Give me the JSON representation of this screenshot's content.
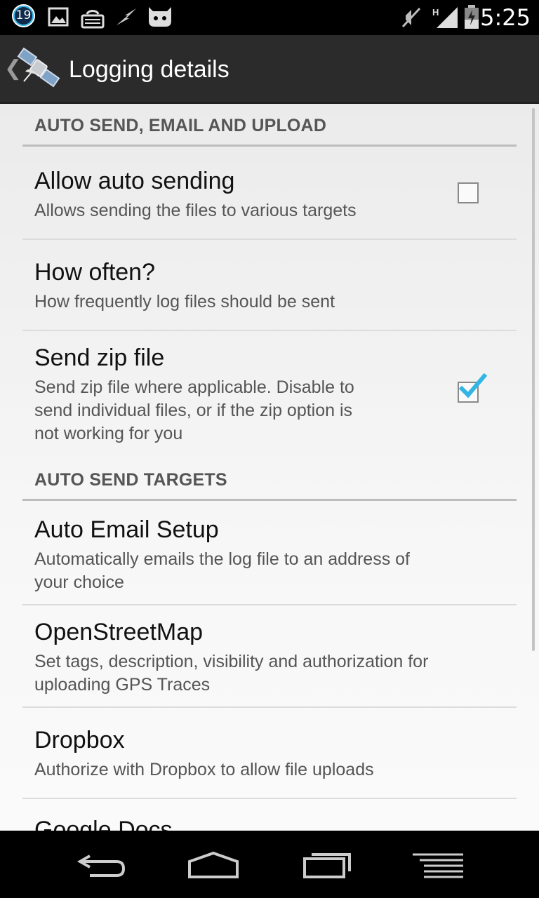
{
  "status_bar": {
    "notification_count": "19",
    "time": "5:25",
    "icons": [
      "notification-count-badge",
      "image-icon",
      "keyboard-icon",
      "lightning-icon",
      "android-cat-icon",
      "mute-icon",
      "signal-icon",
      "battery-icon"
    ]
  },
  "action_bar": {
    "title": "Logging details",
    "app_icon": "satellite-icon"
  },
  "sections": [
    {
      "header": "AUTO SEND, EMAIL AND UPLOAD",
      "items": [
        {
          "title": "Allow auto sending",
          "summary": "Allows sending the files to various targets",
          "checkbox": true,
          "checked": false
        },
        {
          "title": "How often?",
          "summary": "How frequently log files should be sent",
          "checkbox": false
        },
        {
          "title": "Send zip file",
          "summary_lines": [
            "Send zip file where applicable. Disable to",
            "send individual files, or if the zip option is",
            "not working for you"
          ],
          "checkbox": true,
          "checked": true
        }
      ]
    },
    {
      "header": "AUTO SEND TARGETS",
      "items": [
        {
          "title": "Auto Email Setup",
          "summary_lines": [
            "Automatically emails the log file to an address of",
            "your choice"
          ]
        },
        {
          "title": "OpenStreetMap",
          "summary_lines": [
            "Set tags, description, visibility and authorization for",
            "uploading GPS Traces"
          ]
        },
        {
          "title": "Dropbox",
          "summary": "Authorize with Dropbox to allow file uploads"
        },
        {
          "title": "Google Docs"
        }
      ]
    }
  ],
  "colors": {
    "accent": "#33b5e5",
    "action_bar": "#2b2b2b",
    "background": "#f5f5f5"
  },
  "nav_bar": [
    "back-icon",
    "home-icon",
    "recent-apps-icon",
    "menu-icon"
  ]
}
